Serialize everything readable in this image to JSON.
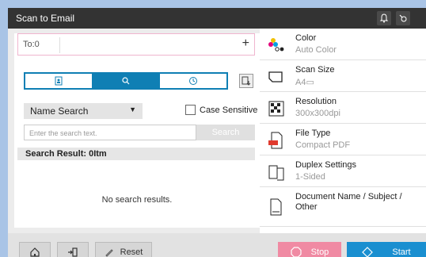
{
  "titlebar": {
    "title": "Scan to Email",
    "icons": [
      "bell-icon",
      "settings-icon"
    ]
  },
  "destination": {
    "label": "To:0",
    "add_label": "+"
  },
  "tabs": [
    {
      "name": "address-book-icon",
      "active": false
    },
    {
      "name": "search-icon",
      "active": true
    },
    {
      "name": "history-icon",
      "active": false
    }
  ],
  "search": {
    "mode": "Name Search",
    "case_label": "Case Sensitive",
    "placeholder": "Enter the search text.",
    "button": "Search",
    "result": "Search Result: 0Itm",
    "empty": "No search results."
  },
  "settings": [
    {
      "name": "Color",
      "value": "Auto Color",
      "icon": "color-icon"
    },
    {
      "name": "Scan Size",
      "value": "A4▭",
      "icon": "scan-size-icon"
    },
    {
      "name": "Resolution",
      "value": "300x300dpi",
      "icon": "resolution-icon"
    },
    {
      "name": "File Type",
      "value": "Compact PDF",
      "icon": "pdf-icon"
    },
    {
      "name": "Duplex Settings",
      "value": "1-Sided",
      "icon": "duplex-icon"
    },
    {
      "name": "Document Name / Subject / Other",
      "value": "",
      "icon": "document-icon"
    }
  ],
  "footer": {
    "reset": "Reset",
    "stop": "Stop",
    "start": "Start"
  },
  "colors": {
    "titlebar": "#333333",
    "accent": "#0f7fb4",
    "stop": "#f08aa3",
    "start": "#1a8fd0"
  }
}
